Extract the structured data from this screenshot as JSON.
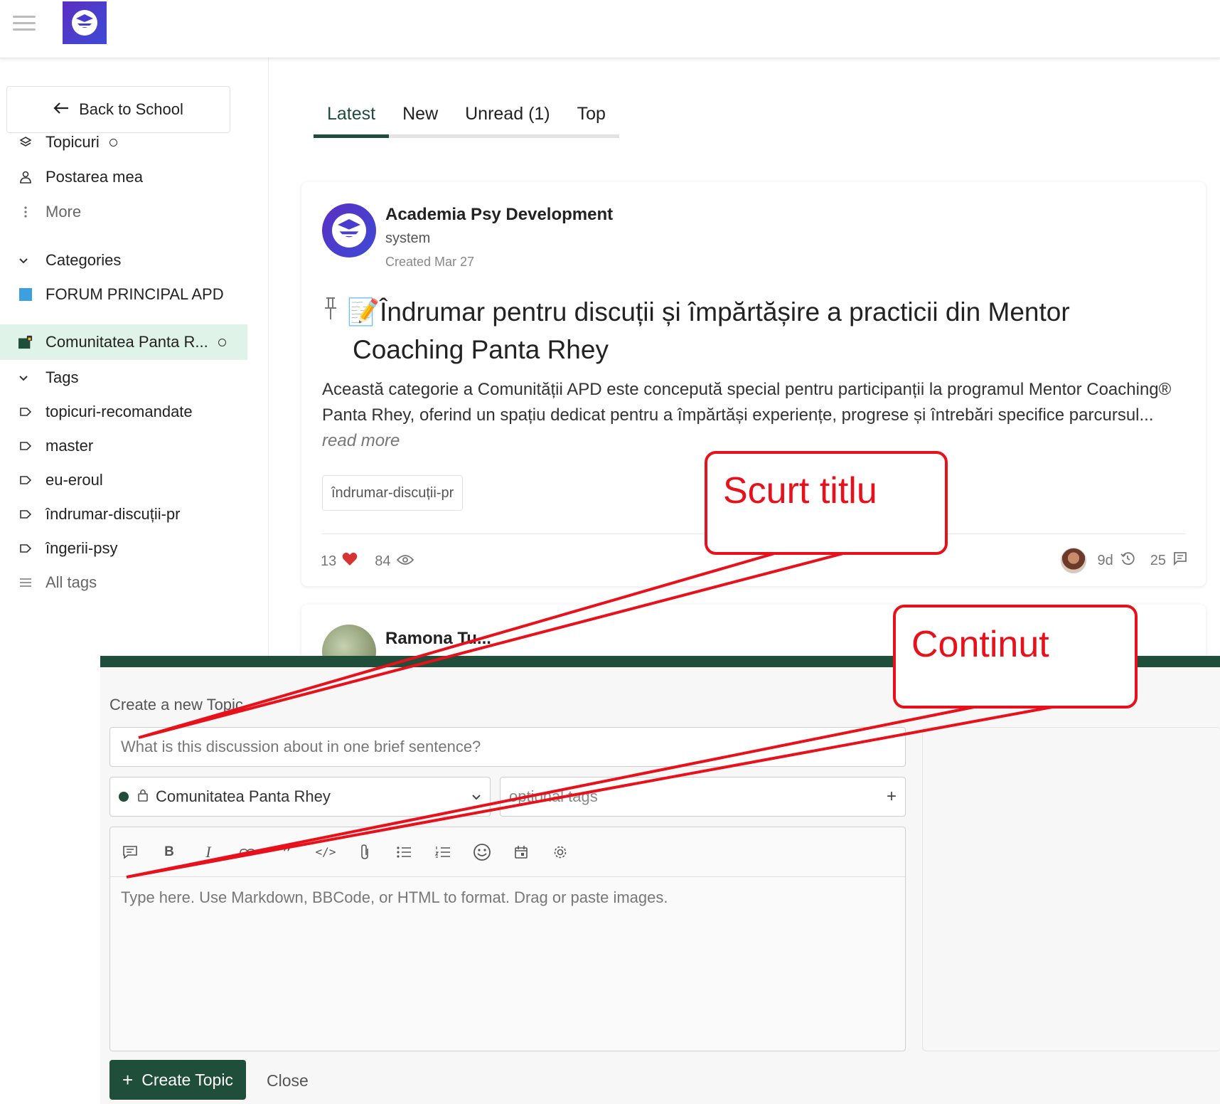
{
  "header": {
    "menu_icon": "hamburger-icon",
    "logo_icon": "academy-logo-icon"
  },
  "sidebar": {
    "back_label": "Back to School",
    "nav": [
      {
        "label": "Topicuri",
        "icon": "layers-icon"
      },
      {
        "label": "Postarea mea",
        "icon": "user-icon"
      },
      {
        "label": "More",
        "icon": "vertical-dots-icon"
      }
    ],
    "categories_heading": "Categories",
    "categories": [
      {
        "label": "FORUM PRINCIPAL APD",
        "color": "#3b9fe0"
      },
      {
        "label": "Comunitatea Panta R...",
        "color": "#1f4e3a"
      }
    ],
    "tags_heading": "Tags",
    "tags": [
      "topicuri-recomandate",
      "master",
      "eu-eroul",
      "îndrumar-discuții-pr",
      "îngerii-psy"
    ],
    "all_tags": "All tags"
  },
  "tabs": [
    "Latest",
    "New",
    "Unread (1)",
    "Top"
  ],
  "topic": {
    "author": "Academia Psy Development",
    "author_sub": "system",
    "created": "Created Mar 27",
    "title_line1": "📝Îndrumar pentru discuții și împărtășire a practicii din Mentor",
    "title_line2": "Coaching Panta Rhey",
    "excerpt": "Această categorie a Comunității APD este concepută special pentru participanții la programul Mentor Coaching® Panta Rhey, oferind un spațiu dedicat pentru a împărtăși experiențe, progrese și întrebări specifice parcursul...",
    "read_more": "read more",
    "tag": "îndrumar-discuții-pr",
    "likes": "13",
    "views": "84",
    "activity": "9d",
    "replies": "25"
  },
  "second_topic": {
    "author": "Ramona Tu..."
  },
  "composer": {
    "heading": "Create a new Topic",
    "title_placeholder": "What is this discussion about in one brief sentence?",
    "category": "Comunitatea Panta Rhey",
    "tags_placeholder": "optional tags",
    "editor_placeholder": "Type here. Use Markdown, BBCode, or HTML to format. Drag or paste images.",
    "create_label": "Create Topic",
    "close_label": "Close",
    "accent": "#1f4e3a"
  },
  "annotations": {
    "callout1": "Scurt titlu",
    "callout2": "Continut",
    "color": "#e8101a"
  }
}
